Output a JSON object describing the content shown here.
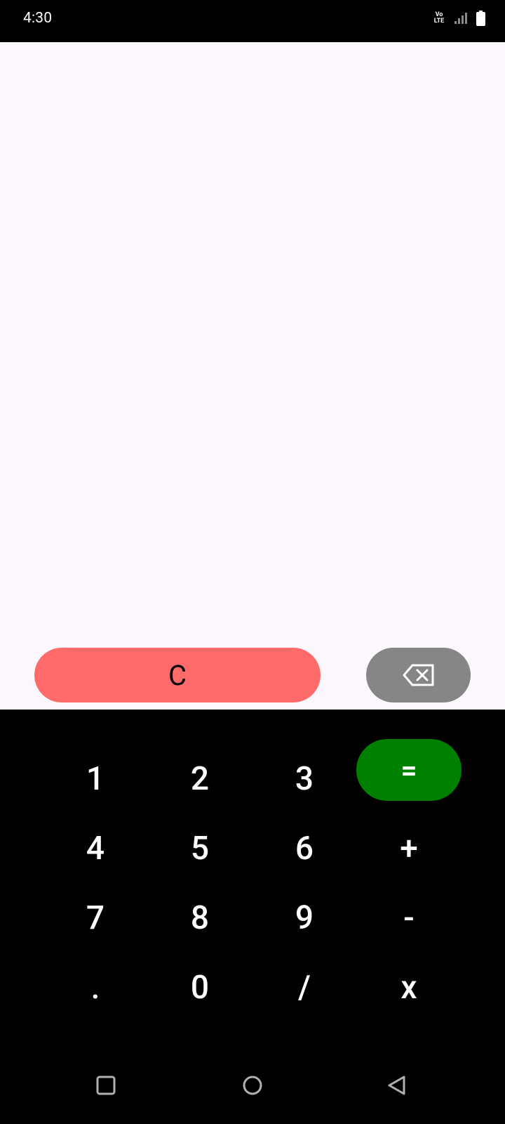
{
  "status_bar": {
    "time": "4:30",
    "volte_line1": "Vo",
    "volte_line2": "LTE"
  },
  "display": {
    "expression": ""
  },
  "controls": {
    "clear_label": "C",
    "backspace_icon": "backspace-icon"
  },
  "keypad": {
    "row1": [
      "1",
      "2",
      "3",
      "="
    ],
    "row2": [
      "4",
      "5",
      "6",
      "+"
    ],
    "row3": [
      "7",
      "8",
      "9",
      "-"
    ],
    "row4": [
      ".",
      "0",
      "/",
      "x"
    ]
  },
  "nav": {
    "recents_icon": "square-icon",
    "home_icon": "circle-icon",
    "back_icon": "triangle-back-icon"
  },
  "colors": {
    "display_bg": "#fcf6fd",
    "clear_button": "#ff6a6a",
    "backspace_button": "#868686",
    "equals_button": "#008000",
    "keypad_bg": "#000000"
  }
}
